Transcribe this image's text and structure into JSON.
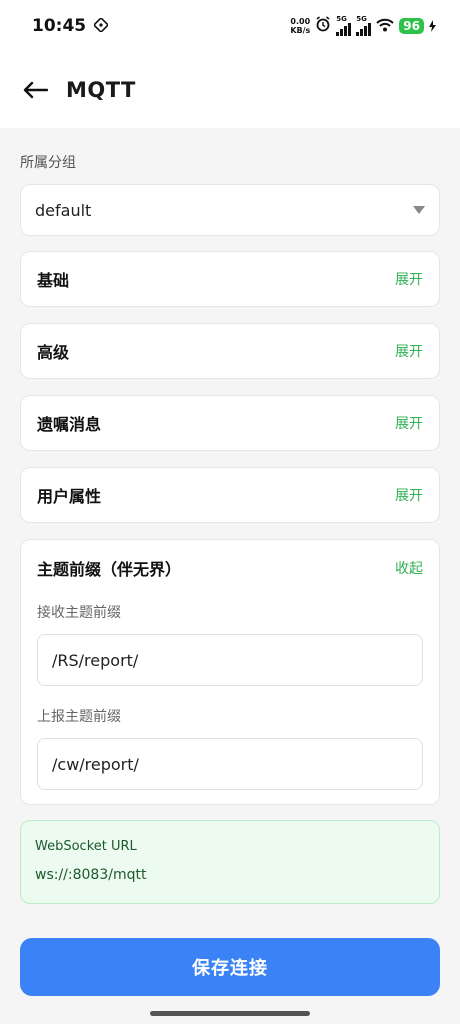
{
  "status": {
    "time": "10:45",
    "net_speed_value": "0.00",
    "net_speed_unit": "KB/s",
    "signal1_label": "5G",
    "signal2_label": "5G",
    "battery": "96"
  },
  "header": {
    "title": "MQTT"
  },
  "group": {
    "label": "所属分组",
    "selected": "default"
  },
  "sections": [
    {
      "name": "基础",
      "toggle": "展开"
    },
    {
      "name": "高级",
      "toggle": "展开"
    },
    {
      "name": "遗嘱消息",
      "toggle": "展开"
    },
    {
      "name": "用户属性",
      "toggle": "展开"
    }
  ],
  "topic_prefix": {
    "name": "主题前缀（伴无界）",
    "toggle": "收起",
    "receive_label": "接收主题前缀",
    "receive_value": "/RS/report/",
    "report_label": "上报主题前缀",
    "report_value": "/cw/report/"
  },
  "websocket": {
    "label": "WebSocket URL",
    "url": "ws://:8083/mqtt"
  },
  "save_button": "保存连接",
  "colors": {
    "accent_green": "#2fb152",
    "primary_blue": "#3b82f6",
    "ws_bg": "#ecfaef"
  }
}
